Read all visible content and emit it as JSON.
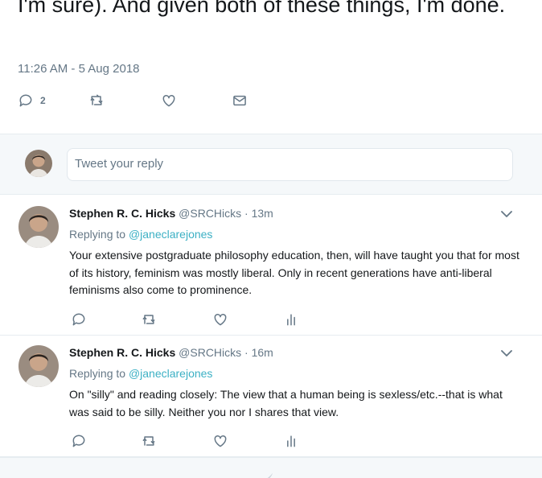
{
  "main_tweet": {
    "text": "I'm sure). And given both of these things, I'm done.",
    "timestamp": "11:26 AM - 5 Aug 2018",
    "actions": {
      "reply_count": "2"
    }
  },
  "reply_box": {
    "placeholder": "Tweet your reply"
  },
  "replies": [
    {
      "name": "Stephen R. C. Hicks",
      "handle": "@SRCHicks",
      "separator": "·",
      "time": "13m",
      "replying_prefix": "Replying to",
      "replying_to": "@janeclarejones",
      "text": "Your extensive postgraduate philosophy education, then, will have taught you that for most of its history, feminism was mostly liberal. Only in recent generations have anti-liberal feminisms also come to prominence."
    },
    {
      "name": "Stephen R. C. Hicks",
      "handle": "@SRCHicks",
      "separator": "·",
      "time": "16m",
      "replying_prefix": "Replying to",
      "replying_to": "@janeclarejones",
      "text": "On \"silly\" and reading closely: The view that a human being is sexless/etc.--that is what was said to be silly. Neither you nor I shares that view."
    }
  ],
  "icons": {
    "reply": "reply-icon",
    "retweet": "retweet-icon",
    "like": "heart-icon",
    "dm": "envelope-icon",
    "analytics": "analytics-icon",
    "caret": "chevron-down-icon",
    "bird": "twitter-bird-icon"
  },
  "colors": {
    "link": "#3cb0c4",
    "muted": "#657786",
    "text": "#14171a",
    "divider": "#e6ecf0",
    "reply_bg": "#f5f8fa"
  }
}
